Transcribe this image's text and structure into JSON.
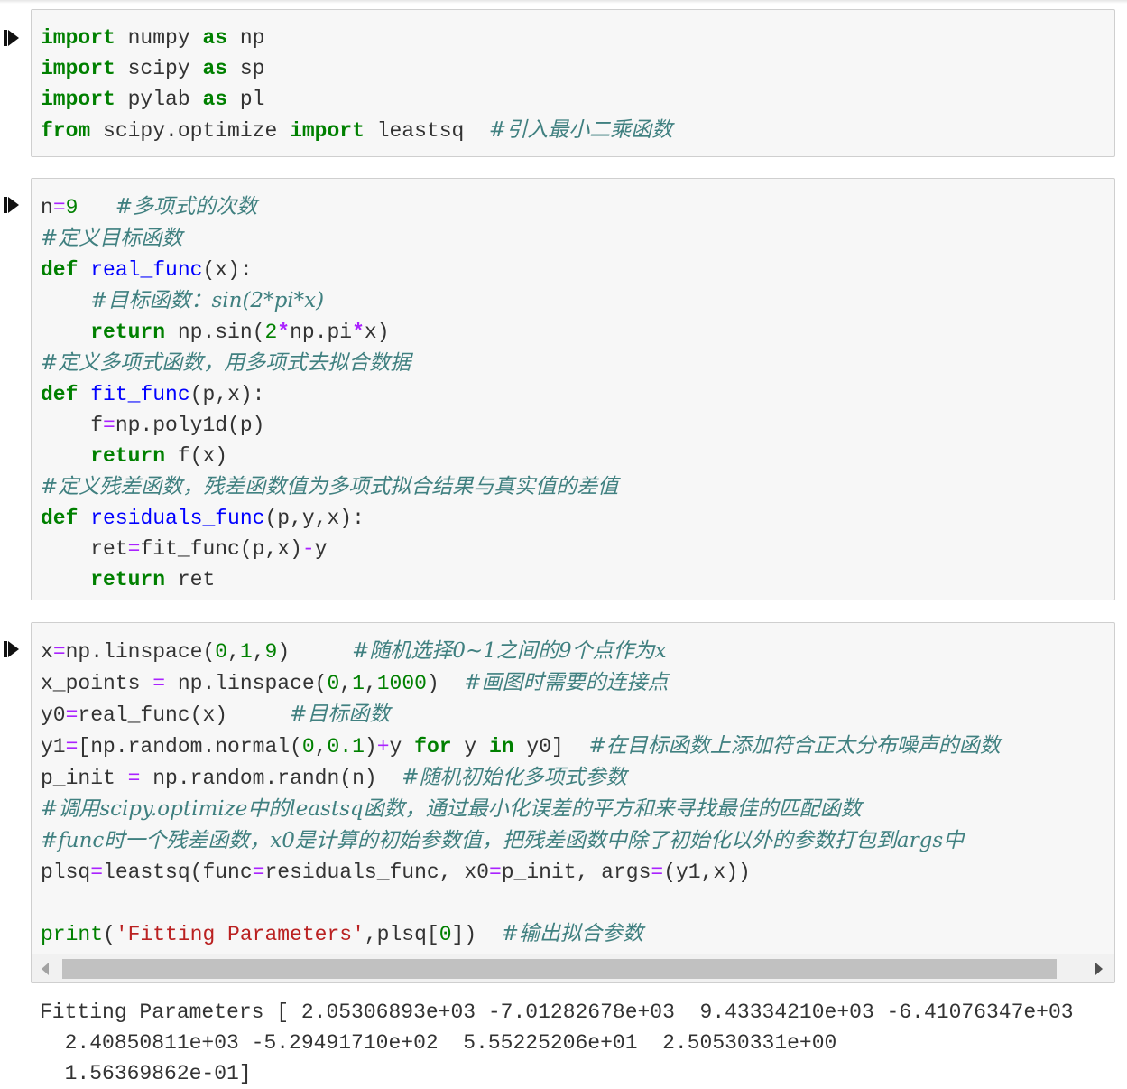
{
  "cells": [
    {
      "lines": [
        [
          [
            "kw",
            "import"
          ],
          [
            "t",
            " numpy "
          ],
          [
            "kw",
            "as"
          ],
          [
            "t",
            " np"
          ]
        ],
        [
          [
            "kw",
            "import"
          ],
          [
            "t",
            " scipy "
          ],
          [
            "kw",
            "as"
          ],
          [
            "t",
            " sp"
          ]
        ],
        [
          [
            "kw",
            "import"
          ],
          [
            "t",
            " pylab "
          ],
          [
            "kw",
            "as"
          ],
          [
            "t",
            " pl"
          ]
        ],
        [
          [
            "kw",
            "from"
          ],
          [
            "t",
            " scipy.optimize "
          ],
          [
            "kw",
            "import"
          ],
          [
            "t",
            " leastsq  "
          ],
          [
            "cm",
            "#引入最小二乘函数"
          ]
        ]
      ]
    },
    {
      "lines": [
        [
          [
            "t",
            "n"
          ],
          [
            "eq",
            "="
          ],
          [
            "num",
            "9"
          ],
          [
            "t",
            "   "
          ],
          [
            "cm",
            "#多项式的次数"
          ]
        ],
        [
          [
            "cm",
            "#定义目标函数"
          ]
        ],
        [
          [
            "kw",
            "def"
          ],
          [
            "t",
            " "
          ],
          [
            "fn",
            "real_func"
          ],
          [
            "t",
            "(x):"
          ]
        ],
        [
          [
            "t",
            "    "
          ],
          [
            "cm",
            "#目标函数：sin(2*pi*x)"
          ]
        ],
        [
          [
            "t",
            "    "
          ],
          [
            "kw",
            "return"
          ],
          [
            "t",
            " np.sin("
          ],
          [
            "num",
            "2"
          ],
          [
            "op",
            "*"
          ],
          [
            "t",
            "np.pi"
          ],
          [
            "op",
            "*"
          ],
          [
            "t",
            "x)"
          ]
        ],
        [
          [
            "cm",
            "#定义多项式函数，用多项式去拟合数据"
          ]
        ],
        [
          [
            "kw",
            "def"
          ],
          [
            "t",
            " "
          ],
          [
            "fn",
            "fit_func"
          ],
          [
            "t",
            "(p,x):"
          ]
        ],
        [
          [
            "t",
            "    f"
          ],
          [
            "eq",
            "="
          ],
          [
            "t",
            "np.poly1d(p)"
          ]
        ],
        [
          [
            "t",
            "    "
          ],
          [
            "kw",
            "return"
          ],
          [
            "t",
            " f(x)"
          ]
        ],
        [
          [
            "cm",
            "#定义残差函数，残差函数值为多项式拟合结果与真实值的差值"
          ]
        ],
        [
          [
            "kw",
            "def"
          ],
          [
            "t",
            " "
          ],
          [
            "fn",
            "residuals_func"
          ],
          [
            "t",
            "(p,y,x):"
          ]
        ],
        [
          [
            "t",
            "    ret"
          ],
          [
            "eq",
            "="
          ],
          [
            "t",
            "fit_func(p,x)"
          ],
          [
            "eq",
            "-"
          ],
          [
            "t",
            "y"
          ]
        ],
        [
          [
            "t",
            "    "
          ],
          [
            "kw",
            "return"
          ],
          [
            "t",
            " ret"
          ]
        ]
      ]
    },
    {
      "lines": [
        [
          [
            "t",
            "x"
          ],
          [
            "eq",
            "="
          ],
          [
            "t",
            "np.linspace("
          ],
          [
            "num",
            "0"
          ],
          [
            "t",
            ","
          ],
          [
            "num",
            "1"
          ],
          [
            "t",
            ","
          ],
          [
            "num",
            "9"
          ],
          [
            "t",
            ")     "
          ],
          [
            "cm",
            "#随机选择0~1之间的9个点作为x"
          ]
        ],
        [
          [
            "t",
            "x_points "
          ],
          [
            "eq",
            "="
          ],
          [
            "t",
            " np.linspace("
          ],
          [
            "num",
            "0"
          ],
          [
            "t",
            ","
          ],
          [
            "num",
            "1"
          ],
          [
            "t",
            ","
          ],
          [
            "num",
            "1000"
          ],
          [
            "t",
            ")  "
          ],
          [
            "cm",
            "#画图时需要的连接点"
          ]
        ],
        [
          [
            "t",
            "y0"
          ],
          [
            "eq",
            "="
          ],
          [
            "t",
            "real_func(x)     "
          ],
          [
            "cm",
            "#目标函数"
          ]
        ],
        [
          [
            "t",
            "y1"
          ],
          [
            "eq",
            "="
          ],
          [
            "t",
            "[np.random.normal("
          ],
          [
            "num",
            "0"
          ],
          [
            "t",
            ","
          ],
          [
            "num",
            "0.1"
          ],
          [
            "t",
            ")"
          ],
          [
            "eq",
            "+"
          ],
          [
            "t",
            "y "
          ],
          [
            "kw",
            "for"
          ],
          [
            "t",
            " y "
          ],
          [
            "kw",
            "in"
          ],
          [
            "t",
            " y0]  "
          ],
          [
            "cm",
            "#在目标函数上添加符合正太分布噪声的函数"
          ]
        ],
        [
          [
            "t",
            "p_init "
          ],
          [
            "eq",
            "="
          ],
          [
            "t",
            " np.random.randn(n)  "
          ],
          [
            "cm",
            "#随机初始化多项式参数"
          ]
        ],
        [
          [
            "cm",
            "#调用scipy.optimize中的leastsq函数，通过最小化误差的平方和来寻找最佳的匹配函数"
          ]
        ],
        [
          [
            "cm",
            "#func时一个残差函数，x0是计算的初始参数值，把残差函数中除了初始化以外的参数打包到args中"
          ]
        ],
        [
          [
            "t",
            "plsq"
          ],
          [
            "eq",
            "="
          ],
          [
            "t",
            "leastsq(func"
          ],
          [
            "eq",
            "="
          ],
          [
            "t",
            "residuals_func, x0"
          ],
          [
            "eq",
            "="
          ],
          [
            "t",
            "p_init, args"
          ],
          [
            "eq",
            "="
          ],
          [
            "t",
            "(y1,x))"
          ]
        ],
        [
          [
            "t",
            ""
          ]
        ],
        [
          [
            "nb",
            "print"
          ],
          [
            "t",
            "("
          ],
          [
            "str",
            "'Fitting Parameters'"
          ],
          [
            "t",
            ",plsq["
          ],
          [
            "num",
            "0"
          ],
          [
            "t",
            "])  "
          ],
          [
            "cm",
            "#输出拟合参数"
          ]
        ]
      ]
    }
  ],
  "output": "Fitting Parameters [ 2.05306893e+03 -7.01282678e+03  9.43334210e+03 -6.41076347e+03\n  2.40850811e+03 -5.29491710e+02  5.55225206e+01  2.50530331e+00\n  1.56369862e-01]"
}
